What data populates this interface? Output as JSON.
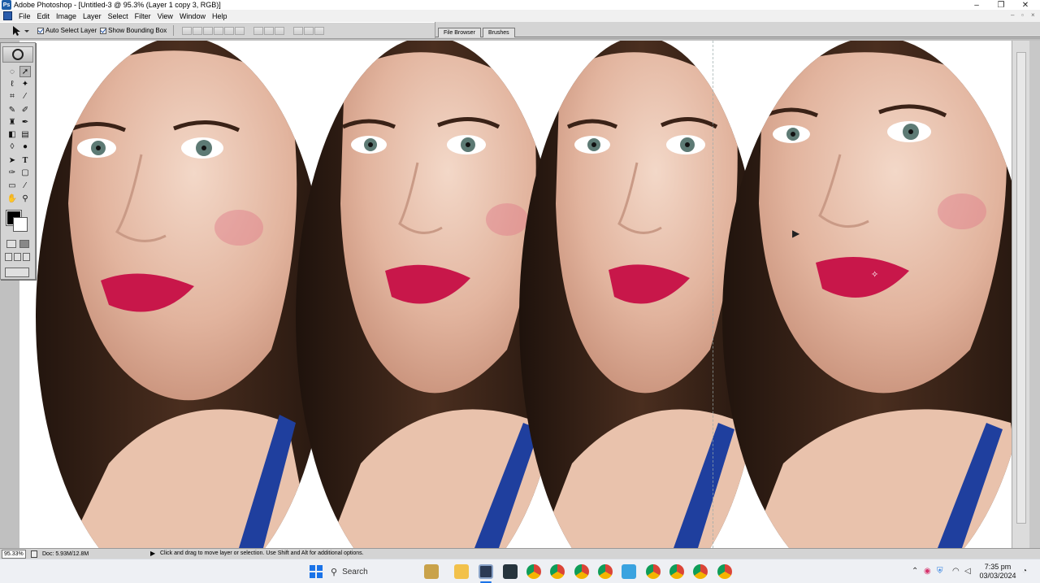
{
  "window": {
    "title": "Adobe Photoshop - [Untitled-3 @ 95.3% (Layer 1 copy 3, RGB)]",
    "app_icon": "Ps",
    "controls": {
      "minimize": "–",
      "restore": "❐",
      "close": "✕"
    }
  },
  "menubar": {
    "items": [
      "File",
      "Edit",
      "Image",
      "Layer",
      "Select",
      "Filter",
      "View",
      "Window",
      "Help"
    ],
    "mdi_controls": {
      "minimize": "–",
      "restore": "▫",
      "close": "×"
    }
  },
  "options_bar": {
    "tool_preset_icon": "move-tool-icon",
    "auto_select_layer": {
      "label": "Auto Select Layer",
      "checked": true
    },
    "show_bounding_box": {
      "label": "Show Bounding Box",
      "checked": true
    }
  },
  "palette_well": {
    "tabs": [
      "File Browser",
      "Brushes"
    ]
  },
  "canvas": {
    "content": "four-oval-portraits"
  },
  "status_bar": {
    "zoom": "95.33%",
    "doc_size": "Doc: 5.93M/12.8M",
    "hint": "Click and drag to move layer or selection.  Use Shift and Alt for additional options."
  },
  "taskbar": {
    "search_label": "Search",
    "time": "7:35 pm",
    "date": "03/03/2024",
    "colors": {
      "start": "#1a73e8",
      "accent": "#1a73e8"
    }
  },
  "colors": {
    "foreground": "#000000",
    "background": "#ffffff",
    "lip": "#c8174a",
    "hair": "#3a2217",
    "skin": "#e6b9a2",
    "top": "#1f3f9e"
  }
}
